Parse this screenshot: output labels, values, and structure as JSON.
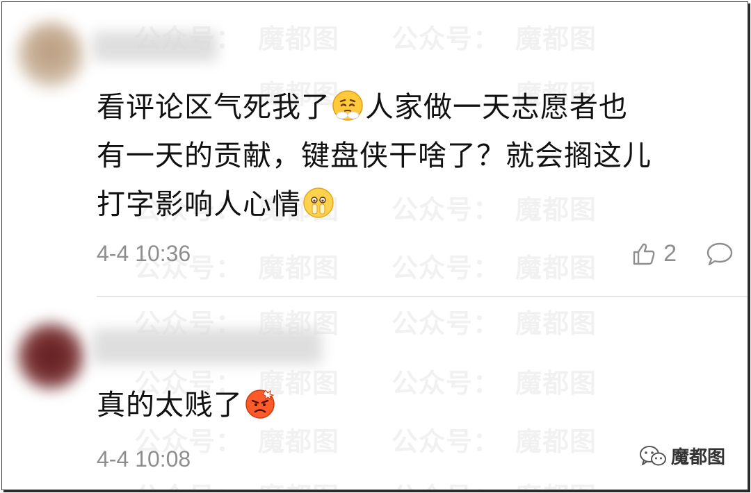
{
  "watermark": {
    "text": "公众号：魔都图",
    "part1": "公众号：",
    "part2": "魔都图"
  },
  "comments": [
    {
      "lines": [
        "看评论区气死我了",
        "人家做一天志愿者也",
        "有一天的贡献，键盘侠干啥了？就会搁这儿",
        "打字影响人心情"
      ],
      "time": "4-4 10:36",
      "likes": "2"
    },
    {
      "text": "真的太贱了",
      "time": "4-4 10:08"
    }
  ],
  "brand": {
    "label": "魔都图"
  },
  "icons": {
    "emoji1": "angry-steam-emoji-icon",
    "emoji2": "salute-emoji-icon",
    "emoji3": "angry-red-face-emoji-icon",
    "like": "thumbs-up-icon",
    "reply": "speech-bubble-icon",
    "brand": "wechat-logo-icon"
  },
  "colors": {
    "text": "#111111",
    "meta": "#8e8e8e",
    "divider": "#e6e6e6"
  }
}
